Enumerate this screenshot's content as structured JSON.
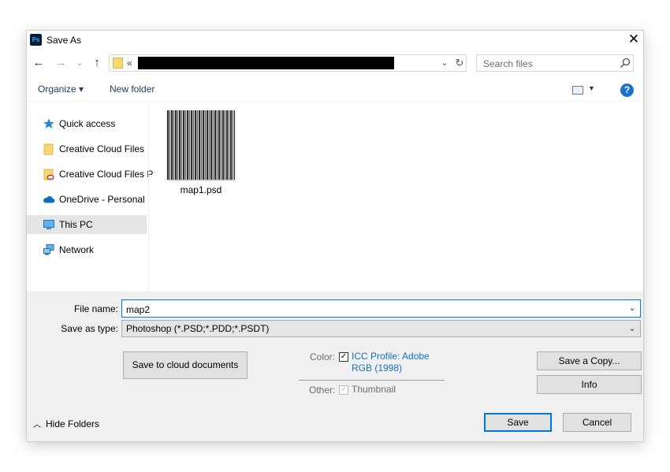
{
  "window": {
    "title": "Save As",
    "app_icon": "Ps",
    "close_glyph": "✕"
  },
  "nav": {
    "back_glyph": "←",
    "forward_glyph": "→",
    "recent_glyph": "⌄",
    "up_glyph": "↑",
    "breadcrumb_prefix": "«",
    "dropdown_glyph": "⌄",
    "refresh_glyph": "↻"
  },
  "search": {
    "placeholder": "Search files"
  },
  "toolbar": {
    "organize_label": "Organize ▾",
    "new_folder_label": "New folder",
    "help_glyph": "?"
  },
  "sidebar": {
    "items": [
      {
        "label": "Quick access",
        "icon": "star-icon"
      },
      {
        "label": "Creative Cloud Files",
        "icon": "folder-icon"
      },
      {
        "label": "Creative Cloud Files P",
        "icon": "creative-cloud-folder-icon"
      },
      {
        "label": "OneDrive - Personal",
        "icon": "cloud-icon"
      },
      {
        "label": "This PC",
        "icon": "monitor-icon",
        "selected": true
      },
      {
        "label": "Network",
        "icon": "network-icon"
      }
    ]
  },
  "files": [
    {
      "name": "map1.psd"
    }
  ],
  "form": {
    "filename_label": "File name:",
    "filename_value": "map2",
    "savetype_label": "Save as type:",
    "savetype_value": "Photoshop (*.PSD;*.PDD;*.PSDT)"
  },
  "buttons": {
    "cloud": "Save to cloud documents",
    "save_copy": "Save a Copy...",
    "info": "Info",
    "save": "Save",
    "cancel": "Cancel",
    "hide_folders": "Hide Folders"
  },
  "options": {
    "color_label": "Color:",
    "icc_profile_label": "ICC Profile:  Adobe RGB (1998)",
    "icc_checked": true,
    "other_label": "Other:",
    "thumbnail_label": "Thumbnail",
    "thumbnail_checked": true,
    "thumbnail_disabled": true
  },
  "colors": {
    "accent": "#0078d7",
    "link": "#1a6fc4",
    "bottom_panel": "#f0f0f0"
  }
}
